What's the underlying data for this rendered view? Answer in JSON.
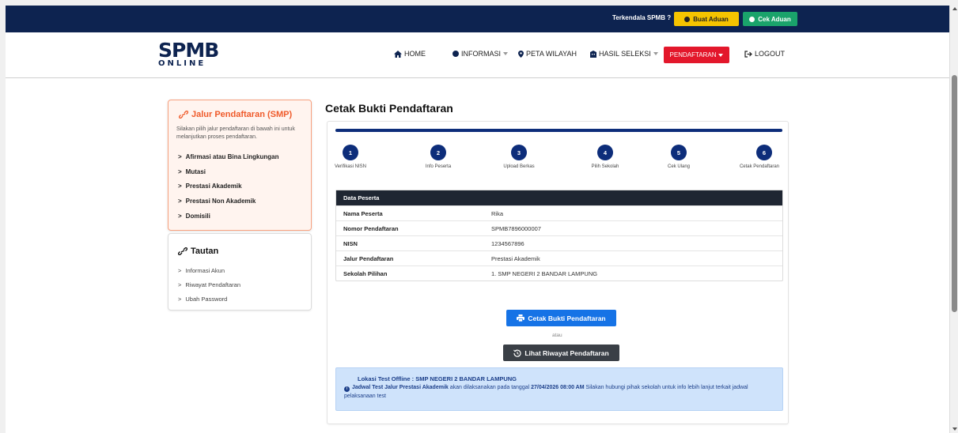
{
  "topbar": {
    "label": "Terkendala SPMB ?",
    "buat_aduan": "Buat Aduan",
    "cek_aduan": "Cek Aduan"
  },
  "logo": {
    "main": "SPMB",
    "sub": "ONLINE"
  },
  "nav": {
    "home": "HOME",
    "informasi": "INFORMASI",
    "peta": "PETA WILAYAH",
    "hasil": "HASIL SELEKSI",
    "pendaftaran": "PENDAFTARAN",
    "logout": "LOGOUT"
  },
  "sidebar": {
    "jalur_title": "Jalur Pendaftaran (SMP)",
    "jalur_desc": "Silakan pilih jalur pendaftaran di bawah ini untuk melanjutkan proses pendaftaran.",
    "jalur_items": [
      "Afirmasi atau Bina Lingkungan",
      "Mutasi",
      "Prestasi Akademik",
      "Prestasi Non Akademik",
      "Domisili"
    ],
    "tautan_title": "Tautan",
    "tautan_items": [
      "Informasi Akun",
      "Riwayat Pendaftaran",
      "Ubah Password"
    ]
  },
  "main": {
    "title": "Cetak Bukti Pendaftaran",
    "steps": [
      {
        "num": "1",
        "label": "Verifikasi NISN"
      },
      {
        "num": "2",
        "label": "Info Peserta"
      },
      {
        "num": "3",
        "label": "Upload Berkas"
      },
      {
        "num": "4",
        "label": "Pilih Sekolah"
      },
      {
        "num": "5",
        "label": "Cek Ulang"
      },
      {
        "num": "6",
        "label": "Cetak Pendaftaran"
      }
    ],
    "table_title": "Data Peserta",
    "rows": [
      {
        "k": "Nama Peserta",
        "v": "Rika"
      },
      {
        "k": "Nomor Pendaftaran",
        "v": "SPMB7896000007"
      },
      {
        "k": "NISN",
        "v": "1234567896"
      },
      {
        "k": "Jalur Pendaftaran",
        "v": "Prestasi Akademik"
      },
      {
        "k": "Sekolah Pilihan",
        "v": "1. SMP NEGERI 2 BANDAR LAMPUNG"
      }
    ],
    "btn_cetak": "Cetak Bukti Pendaftaran",
    "atau": "atau",
    "btn_riwayat": "Lihat Riwayat Pendaftaran",
    "info_line1": "Lokasi Test Offline : SMP NEGERI 2 BANDAR LAMPUNG",
    "info_bold1": "Jadwal Test Jalur Prestasi Akademik",
    "info_mid": " akan dilaksanakan pada tanggal ",
    "info_bold2": "27/04/2026 08:00 AM",
    "info_rest": " Silakan hubungi pihak sekolah untuk info lebih lanjut terkait jadwal pelaksanaan test"
  },
  "colors": {
    "navy": "#0d2350",
    "accent_red": "#e3172b",
    "primary_blue": "#1673e6",
    "orange": "#ef5a2a",
    "yellow": "#f5c400",
    "green": "#1aa36b"
  }
}
